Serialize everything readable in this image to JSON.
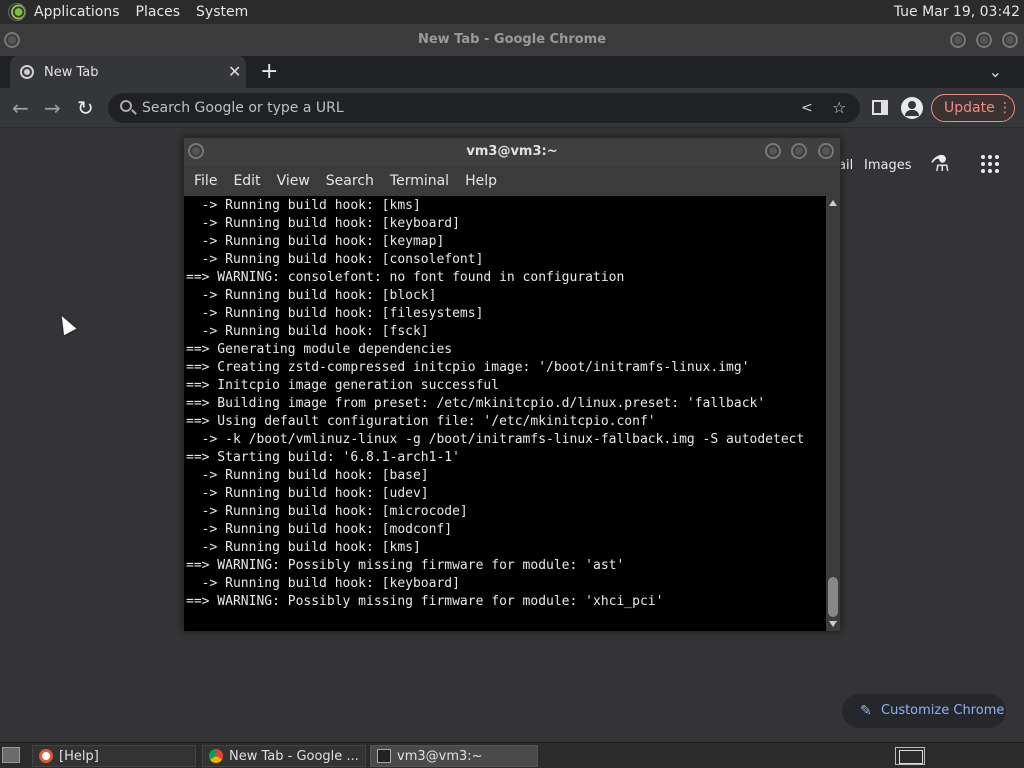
{
  "top_panel": {
    "menu": [
      "Applications",
      "Places",
      "System"
    ],
    "clock": "Tue Mar 19, 03:42"
  },
  "chrome": {
    "window_title": "New Tab - Google Chrome",
    "tab_label": "New Tab",
    "omnibox_placeholder": "Search Google or type a URL",
    "update_label": "Update",
    "links": {
      "gmail_fragment": "ail",
      "images": "Images"
    },
    "customize_label": "Customize Chrome"
  },
  "terminal": {
    "title": "vm3@vm3:~",
    "menu": [
      "File",
      "Edit",
      "View",
      "Search",
      "Terminal",
      "Help"
    ],
    "lines": [
      "  -> Running build hook: [kms]",
      "  -> Running build hook: [keyboard]",
      "  -> Running build hook: [keymap]",
      "  -> Running build hook: [consolefont]",
      "==> WARNING: consolefont: no font found in configuration",
      "  -> Running build hook: [block]",
      "  -> Running build hook: [filesystems]",
      "  -> Running build hook: [fsck]",
      "==> Generating module dependencies",
      "==> Creating zstd-compressed initcpio image: '/boot/initramfs-linux.img'",
      "==> Initcpio image generation successful",
      "==> Building image from preset: /etc/mkinitcpio.d/linux.preset: 'fallback'",
      "==> Using default configuration file: '/etc/mkinitcpio.conf'",
      "  -> -k /boot/vmlinuz-linux -g /boot/initramfs-linux-fallback.img -S autodetect",
      "==> Starting build: '6.8.1-arch1-1'",
      "  -> Running build hook: [base]",
      "  -> Running build hook: [udev]",
      "  -> Running build hook: [microcode]",
      "  -> Running build hook: [modconf]",
      "  -> Running build hook: [kms]",
      "==> WARNING: Possibly missing firmware for module: 'ast'",
      "  -> Running build hook: [keyboard]",
      "==> WARNING: Possibly missing firmware for module: 'xhci_pci'"
    ]
  },
  "taskbar": {
    "items": [
      "[Help]",
      "New Tab - Google ...",
      "vm3@vm3:~"
    ]
  }
}
